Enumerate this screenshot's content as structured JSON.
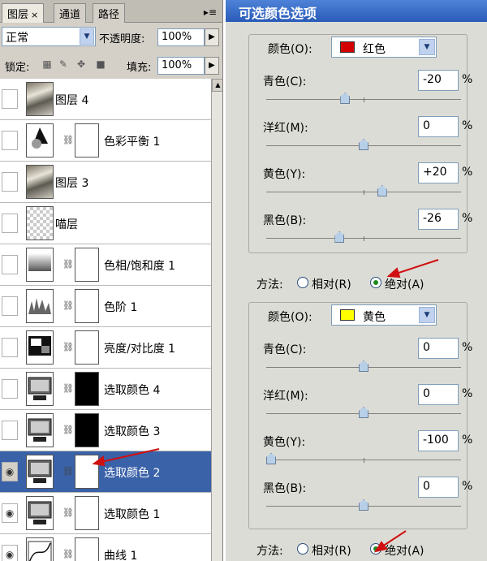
{
  "layers_panel": {
    "tabs": [
      "图层",
      "通道",
      "路径"
    ],
    "tab_close": "×",
    "menu": "▸≡",
    "blend_mode": "正常",
    "opacity_label": "不透明度:",
    "opacity": "100%",
    "lock_label": "锁定:",
    "fill_label": "填充:",
    "fill": "100%",
    "layers": [
      {
        "name": "图层 4",
        "visible": false,
        "selected": false,
        "thumb": "photo",
        "mask": ""
      },
      {
        "name": "色彩平衡 1",
        "visible": false,
        "selected": false,
        "thumb": "adjustment-balance",
        "mask": "white"
      },
      {
        "name": "图层 3",
        "visible": false,
        "selected": false,
        "thumb": "photo",
        "mask": ""
      },
      {
        "name": "喵层",
        "visible": false,
        "selected": false,
        "thumb": "transparent",
        "mask": ""
      },
      {
        "name": "色相/饱和度 1",
        "visible": false,
        "selected": false,
        "thumb": "adjustment-hue",
        "mask": "white"
      },
      {
        "name": "色阶 1",
        "visible": false,
        "selected": false,
        "thumb": "adjustment-levels",
        "mask": "white"
      },
      {
        "name": "亮度/对比度 1",
        "visible": false,
        "selected": false,
        "thumb": "adjustment-brightness",
        "mask": "white"
      },
      {
        "name": "选取颜色 4",
        "visible": false,
        "selected": false,
        "thumb": "adjustment-selective",
        "mask": "black"
      },
      {
        "name": "选取颜色 3",
        "visible": false,
        "selected": false,
        "thumb": "adjustment-selective",
        "mask": "black"
      },
      {
        "name": "选取颜色 2",
        "visible": true,
        "selected": true,
        "thumb": "adjustment-selective",
        "mask": "white"
      },
      {
        "name": "选取颜色 1",
        "visible": true,
        "selected": false,
        "thumb": "adjustment-selective",
        "mask": "white"
      },
      {
        "name": "曲线 1",
        "visible": true,
        "selected": false,
        "thumb": "adjustment-curves",
        "mask": "white"
      }
    ]
  },
  "dialog": {
    "title": "可选颜色选项",
    "upper": {
      "colors_label": "颜色(O):",
      "color": "红色",
      "swatch": "#d40000",
      "sliders": [
        {
          "label": "青色(C):",
          "value": "-20",
          "level": -20
        },
        {
          "label": "洋红(M):",
          "value": "0",
          "level": 0
        },
        {
          "label": "黄色(Y):",
          "value": "+20",
          "level": 20
        },
        {
          "label": "黑色(B):",
          "value": "-26",
          "level": -26
        }
      ],
      "pct": "%",
      "method_label": "方法:",
      "relative_label": "相对(R)",
      "absolute_label": "绝对(A)",
      "method_selected": "absolute"
    },
    "lower": {
      "colors_label": "颜色(O):",
      "color": "黄色",
      "swatch": "#ffff00",
      "sliders": [
        {
          "label": "青色(C):",
          "value": "0",
          "level": 0
        },
        {
          "label": "洋红(M):",
          "value": "0",
          "level": 0
        },
        {
          "label": "黄色(Y):",
          "value": "-100",
          "level": -100
        },
        {
          "label": "黑色(B):",
          "value": "0",
          "level": 0
        }
      ],
      "pct": "%",
      "method_label": "方法:",
      "relative_label": "相对(R)",
      "absolute_label": "绝对(A)",
      "method_selected": "absolute"
    }
  }
}
